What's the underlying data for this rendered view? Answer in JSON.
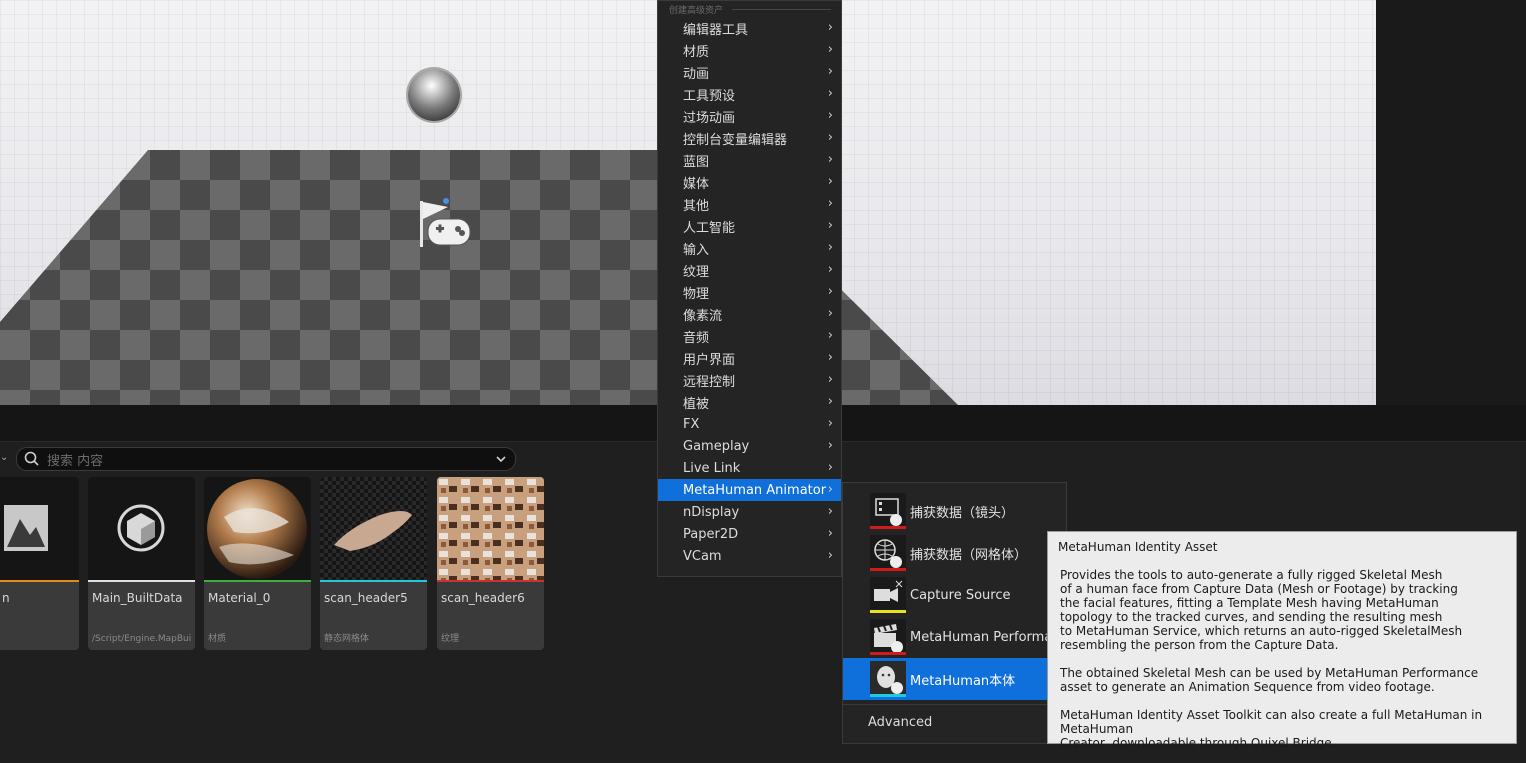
{
  "menu": {
    "section_label": "创建高级资产",
    "items": [
      {
        "label": "编辑器工具"
      },
      {
        "label": "材质"
      },
      {
        "label": "动画"
      },
      {
        "label": "工具预设"
      },
      {
        "label": "过场动画"
      },
      {
        "label": "控制台变量编辑器"
      },
      {
        "label": "蓝图"
      },
      {
        "label": "媒体"
      },
      {
        "label": "其他"
      },
      {
        "label": "人工智能"
      },
      {
        "label": "输入"
      },
      {
        "label": "纹理"
      },
      {
        "label": "物理"
      },
      {
        "label": "像素流"
      },
      {
        "label": "音频"
      },
      {
        "label": "用户界面"
      },
      {
        "label": "远程控制"
      },
      {
        "label": "植被"
      },
      {
        "label": "FX"
      },
      {
        "label": "Gameplay"
      },
      {
        "label": "Live Link"
      },
      {
        "label": "MetaHuman Animator",
        "highlighted": true
      },
      {
        "label": "nDisplay"
      },
      {
        "label": "Paper2D"
      },
      {
        "label": "VCam"
      }
    ]
  },
  "submenu": {
    "items": [
      {
        "label": "捕获数据（镜头）",
        "icon": "capture-footage-icon",
        "underline": "#d11a1a"
      },
      {
        "label": "捕获数据（网格体）",
        "icon": "capture-mesh-icon",
        "underline": "#d11a1a"
      },
      {
        "label": "Capture Source",
        "icon": "capture-source-icon",
        "underline": "#e8e020"
      },
      {
        "label": "MetaHuman Performance",
        "icon": "performance-icon",
        "underline": "#d11a1a"
      },
      {
        "label": "MetaHuman本体",
        "icon": "identity-icon",
        "underline": "#20c8e0",
        "highlighted": true
      }
    ],
    "advanced_label": "Advanced"
  },
  "tooltip": {
    "title": "MetaHuman Identity Asset",
    "body": "Provides the tools to auto-generate a fully rigged Skeletal Mesh\nof a human face from Capture Data (Mesh or Footage) by tracking\nthe facial features, fitting a Template Mesh having MetaHuman\ntopology to the tracked curves, and sending the resulting mesh\nto MetaHuman Service, which returns an auto-rigged SkeletalMesh\nresembling the person from the Capture Data.\n\nThe obtained Skeletal Mesh can be used by MetaHuman Performance\nasset to generate an Animation Sequence from video footage.\n\nMetaHuman Identity Asset Toolkit can also create a full MetaHuman in MetaHuman\nCreator, downloadable through Quixel Bridge."
  },
  "content_browser": {
    "search_placeholder": "搜索 内容",
    "assets": [
      {
        "name": "n",
        "type": "",
        "bar_color": "#e08a1a",
        "thumb": "texture-icon"
      },
      {
        "name": "Main_BuiltData",
        "type": "/Script/Engine.MapBuil...",
        "bar_color": "#e0e0e0",
        "thumb": "cube-icon"
      },
      {
        "name": "Material_0",
        "type": "材质",
        "bar_color": "#3fae3f",
        "thumb": "material-sphere"
      },
      {
        "name": "scan_header5",
        "type": "静态网格体",
        "bar_color": "#20c8e0",
        "thumb": "scan-mesh"
      },
      {
        "name": "scan_header6",
        "type": "纹理",
        "bar_color": "#c83232",
        "thumb": "scan-texture"
      }
    ]
  }
}
